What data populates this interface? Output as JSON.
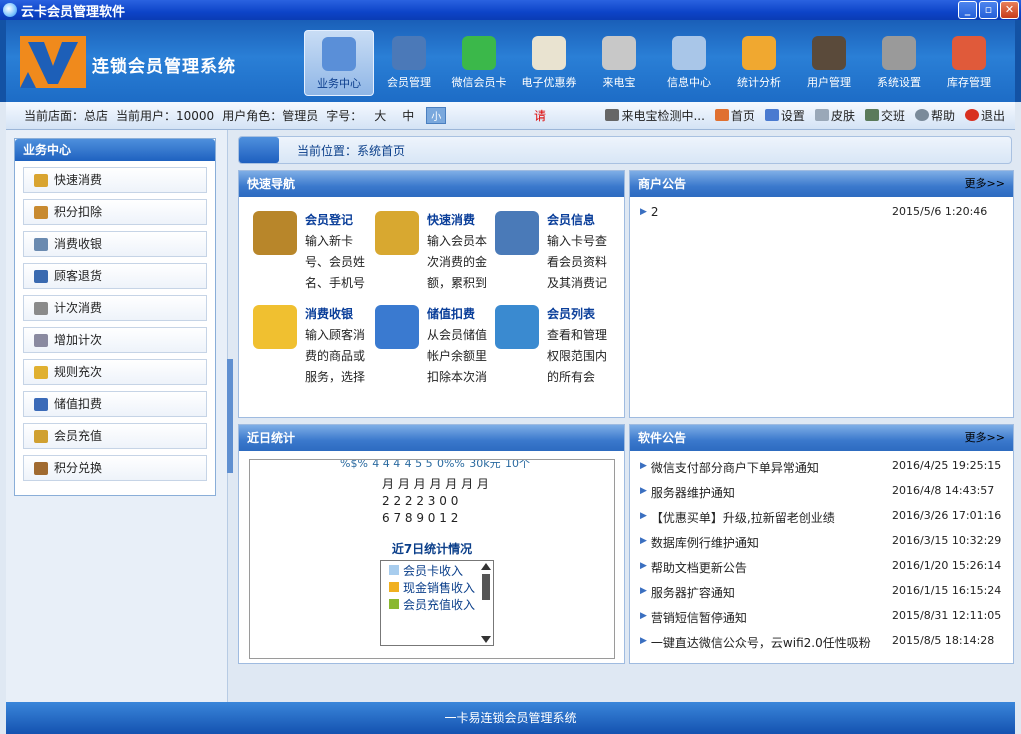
{
  "window": {
    "title": "云卡会员管理软件",
    "minimize": "_",
    "maximize": "▫",
    "close": "✕"
  },
  "header": {
    "app_title": "连锁会员管理系统",
    "nav": [
      {
        "label": "业务中心",
        "icon": "business-center-icon",
        "color": "#5a8fd8",
        "active": true
      },
      {
        "label": "会员管理",
        "icon": "member-management-icon",
        "color": "#4b79b8"
      },
      {
        "label": "微信会员卡",
        "icon": "wechat-icon",
        "color": "#3bb84a"
      },
      {
        "label": "电子优惠券",
        "icon": "coupon-icon",
        "color": "#e9e3d0"
      },
      {
        "label": "来电宝",
        "icon": "phone-icon",
        "color": "#c8c8c8"
      },
      {
        "label": "信息中心",
        "icon": "info-center-icon",
        "color": "#a9c6e8"
      },
      {
        "label": "统计分析",
        "icon": "statistics-icon",
        "color": "#f0a830"
      },
      {
        "label": "用户管理",
        "icon": "user-management-icon",
        "color": "#5a4a3a"
      },
      {
        "label": "系统设置",
        "icon": "settings-tools-icon",
        "color": "#9a9a9a"
      },
      {
        "label": "库存管理",
        "icon": "inventory-icon",
        "color": "#e05a3a"
      }
    ]
  },
  "infobar": {
    "store_label": "当前店面：总店",
    "user_label": "当前用户：10000",
    "role_label": "用户角色：管理员",
    "font_label": "字号：",
    "font_large": "大",
    "font_medium": "中",
    "font_small": "小",
    "red_text": "请",
    "caller_detect": "来电宝检测中...",
    "home": "首页",
    "settings": "设置",
    "skin": "皮肤",
    "shift": "交班",
    "help": "帮助",
    "logout": "退出"
  },
  "sidebar": {
    "title": "业务中心",
    "items": [
      {
        "label": "快速消费",
        "color": "#d9a430"
      },
      {
        "label": "积分扣除",
        "color": "#c88a30"
      },
      {
        "label": "消费收银",
        "color": "#6a8ab0"
      },
      {
        "label": "顾客退货",
        "color": "#3a6ab0"
      },
      {
        "label": "计次消费",
        "color": "#8a8a8a"
      },
      {
        "label": "增加计次",
        "color": "#8a8aa0"
      },
      {
        "label": "规则充次",
        "color": "#e0b030"
      },
      {
        "label": "储值扣费",
        "color": "#3a6ab8"
      },
      {
        "label": "会员充值",
        "color": "#d0a030"
      },
      {
        "label": "积分兑换",
        "color": "#a06a30"
      }
    ]
  },
  "breadcrumb": {
    "text": "当前位置：系统首页"
  },
  "quick_nav": {
    "title": "快速导航",
    "items": [
      {
        "title": "会员登记",
        "desc": "输入新卡号、会员姓名、手机号",
        "color": "#b8862a"
      },
      {
        "title": "快速消费",
        "desc": "输入会员本次消费的金额，累积到",
        "color": "#d8a830"
      },
      {
        "title": "会员信息",
        "desc": "输入卡号查看会员资料及其消费记",
        "color": "#4a7ab8"
      },
      {
        "title": "消费收银",
        "desc": "输入顾客消费的商品或服务，选择",
        "color": "#f0c030"
      },
      {
        "title": "储值扣费",
        "desc": "从会员储值帐户余额里扣除本次消",
        "color": "#3a7ad0"
      },
      {
        "title": "会员列表",
        "desc": "查看和管理权限范围内的所有会",
        "color": "#3a8ad0"
      }
    ]
  },
  "merchant_notice": {
    "title": "商户公告",
    "more": "更多>>",
    "items": [
      {
        "title": "2",
        "date": "2015/5/6 1:20:46"
      }
    ]
  },
  "recent_stats": {
    "title": "近日统计",
    "top_fragments": [
      "%$%",
      "4 4 4",
      "4 5 5",
      "0%%",
      "30k元",
      "10个"
    ],
    "day_rows": [
      "月 月 月 月 月 月 月",
      "2 2 2 2 3 0 0",
      "6 7 8 9 0 1 2"
    ],
    "chart_title": "近7日统计情况",
    "legend": [
      {
        "label": "会员卡收入",
        "color": "#a8cdee"
      },
      {
        "label": "现金销售收入",
        "color": "#f0b020"
      },
      {
        "label": "会员充值收入",
        "color": "#8ab830"
      }
    ]
  },
  "software_notice": {
    "title": "软件公告",
    "more": "更多>>",
    "items": [
      {
        "title": "微信支付部分商户下单异常通知",
        "date": "2016/4/25 19:25:15"
      },
      {
        "title": "服务器维护通知",
        "date": "2016/4/8 14:43:57"
      },
      {
        "title": "【优惠买单】升级,拉新留老创业绩",
        "date": "2016/3/26 17:01:16"
      },
      {
        "title": "数据库例行维护通知",
        "date": "2016/3/15 10:32:29"
      },
      {
        "title": "帮助文档更新公告",
        "date": "2016/1/20 15:26:14"
      },
      {
        "title": "服务器扩容通知",
        "date": "2016/1/15 16:15:24"
      },
      {
        "title": "营销短信暂停通知",
        "date": "2015/8/31 12:11:05"
      },
      {
        "title": "一键直达微信公众号，云wifi2.0任性吸粉",
        "date": "2015/8/5 18:14:28"
      }
    ]
  },
  "footer": {
    "text": "一卡易连锁会员管理系统"
  }
}
